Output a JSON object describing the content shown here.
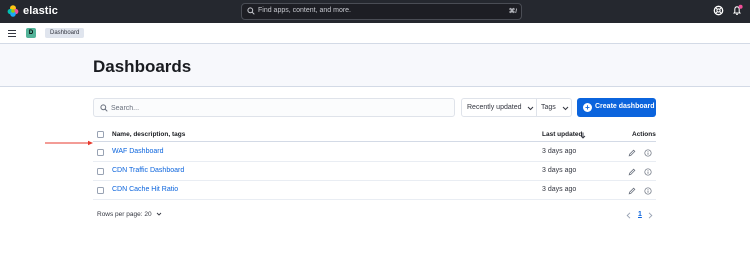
{
  "header": {
    "brand": "elastic",
    "search_placeholder": "Find apps, content, and more.",
    "search_shortcut": "⌘/"
  },
  "subnav": {
    "space_initial": "D",
    "breadcrumb": "Dashboard"
  },
  "page": {
    "title": "Dashboards"
  },
  "toolbar": {
    "search_placeholder": "Search...",
    "sort_label": "Recently updated",
    "tags_label": "Tags",
    "create_label": "Create dashboard"
  },
  "table": {
    "columns": {
      "name": "Name, description, tags",
      "updated": "Last updated",
      "actions": "Actions"
    },
    "rows": [
      {
        "title": "WAF Dashboard",
        "updated": "3 days ago"
      },
      {
        "title": "CDN Traffic Dashboard",
        "updated": "3 days ago"
      },
      {
        "title": "CDN Cache Hit Ratio",
        "updated": "3 days ago"
      }
    ]
  },
  "pagination": {
    "rows_per_page": "Rows per page: 20",
    "current_page": "1"
  },
  "colors": {
    "accent": "#0b64dd",
    "header_bg": "#25282f",
    "annotation_arrow": "#e7382c"
  }
}
